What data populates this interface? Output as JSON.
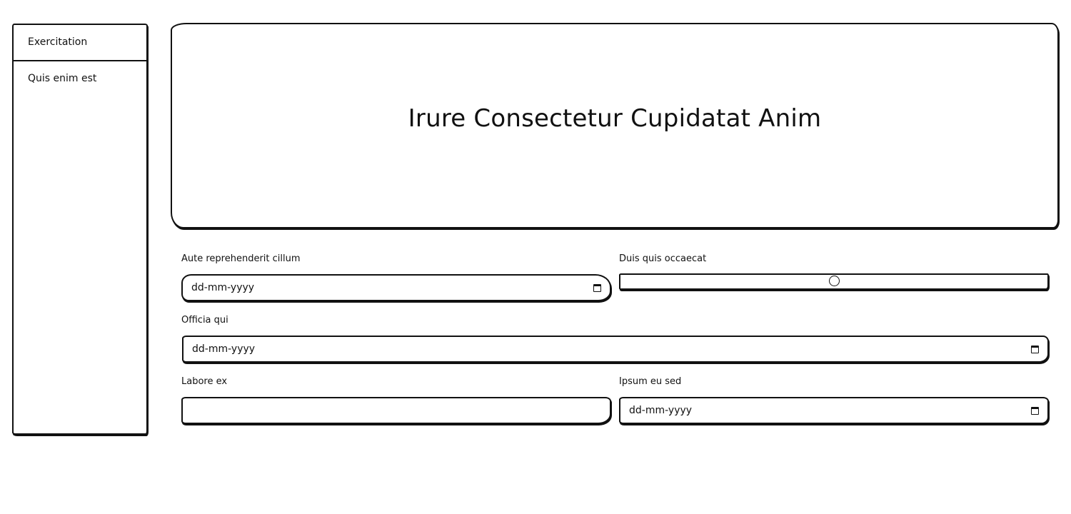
{
  "sidebar": {
    "items": [
      {
        "label": "Exercitation"
      },
      {
        "label": "Quis enim est"
      }
    ]
  },
  "hero": {
    "title": "Irure Consectetur Cupidatat Anim"
  },
  "form": {
    "field1": {
      "label": "Aute reprehenderit cillum",
      "placeholder": "dd-mm-yyyy"
    },
    "range1": {
      "label": "Duis quis occaecat",
      "value_fraction": 0.5
    },
    "field2": {
      "label": "Officia qui",
      "placeholder": "dd-mm-yyyy"
    },
    "field3": {
      "label": "Labore ex",
      "value": ""
    },
    "field4": {
      "label": "Ipsum eu sed",
      "placeholder": "dd-mm-yyyy"
    }
  },
  "icons": {
    "date_picker": "calendar-icon"
  }
}
